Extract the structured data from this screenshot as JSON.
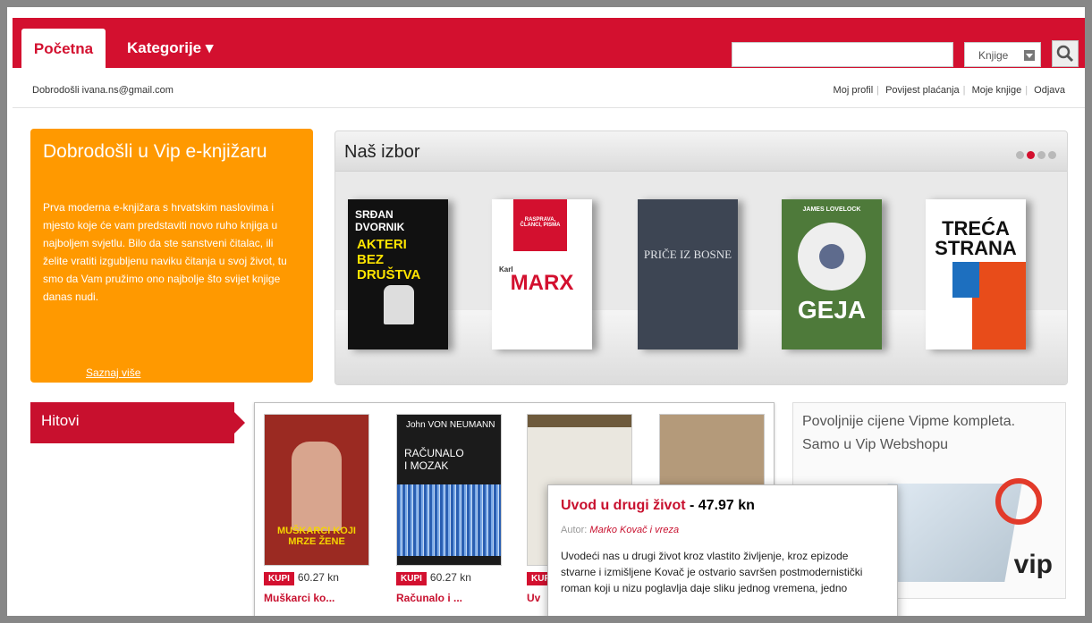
{
  "nav": {
    "home_tab": "Početna",
    "categories_tab": "Kategorije",
    "categories_arrow": "▾",
    "search_placeholder": "",
    "search_type": "Knjige",
    "accent": "#d3102f"
  },
  "userbar": {
    "welcome": "Dobrodošli ivana.ns@gmail.com",
    "links": [
      "Moj profil",
      "Povijest plaćanja",
      "Moje knjige",
      "Odjava"
    ]
  },
  "welcome_box": {
    "title": "Dobrodošli u Vip e-knjižaru",
    "body": "Prva moderna e-knjižara s hrvatskim naslovima i mjesto koje će vam predstaviti novo ruho knjiga u najboljem svjetlu. Bilo da ste sanstveni čitalac, ili želite vratiti izgubljenu naviku čitanja u svoj život, tu smo da Vam pružimo ono najbolje što svijet knjige danas nudi.",
    "more_link": "Saznaj više",
    "color": "#ff9900"
  },
  "featured": {
    "title": "Naš izbor",
    "books": [
      {
        "line1": "SRĐAN",
        "line2": "DVORNIK",
        "title": "AKTERI BEZ DRUŠTVA"
      },
      {
        "small": "RASPRAVA, ČLANCI, PISMA",
        "author": "Karl",
        "title": "MARX"
      },
      {
        "title": "PRIČE IZ BOSNE"
      },
      {
        "author": "JAMES LOVELOCK",
        "title": "GEJA"
      },
      {
        "title": "TREĆA STRANA"
      }
    ]
  },
  "hits": {
    "heading": "Hitovi",
    "buy_label": "KUPI",
    "items": [
      {
        "price": "60.27 kn",
        "title": "Muškarci ko...",
        "cover": "MUŠKARCI KOJI MRZE ŽENE"
      },
      {
        "price": "60.27 kn",
        "title": "Računalo i ...",
        "cover_author": "John VON NEUMANN",
        "cover": "RAČUNALO I MOZAK"
      },
      {
        "price": "",
        "title": "Uv"
      },
      {
        "price": "",
        "title": ""
      }
    ]
  },
  "ad": {
    "line1": "Povoljnije cijene Vipme kompleta.",
    "line2": "Samo u Vip Webshopu",
    "brand": "vip"
  },
  "tooltip": {
    "title": "Uvod u drugi život",
    "price": " - 47.97 kn",
    "author_label": "Autor:",
    "author": "Marko Kovač i vreza",
    "description": "Uvodeći nas u drugi život kroz vlastito življenje, kroz epizode stvarne i izmišljene Kovač je ostvario savršen postmodernistički roman koji u nizu poglavlja daje sliku jednog vremena, jedno"
  }
}
